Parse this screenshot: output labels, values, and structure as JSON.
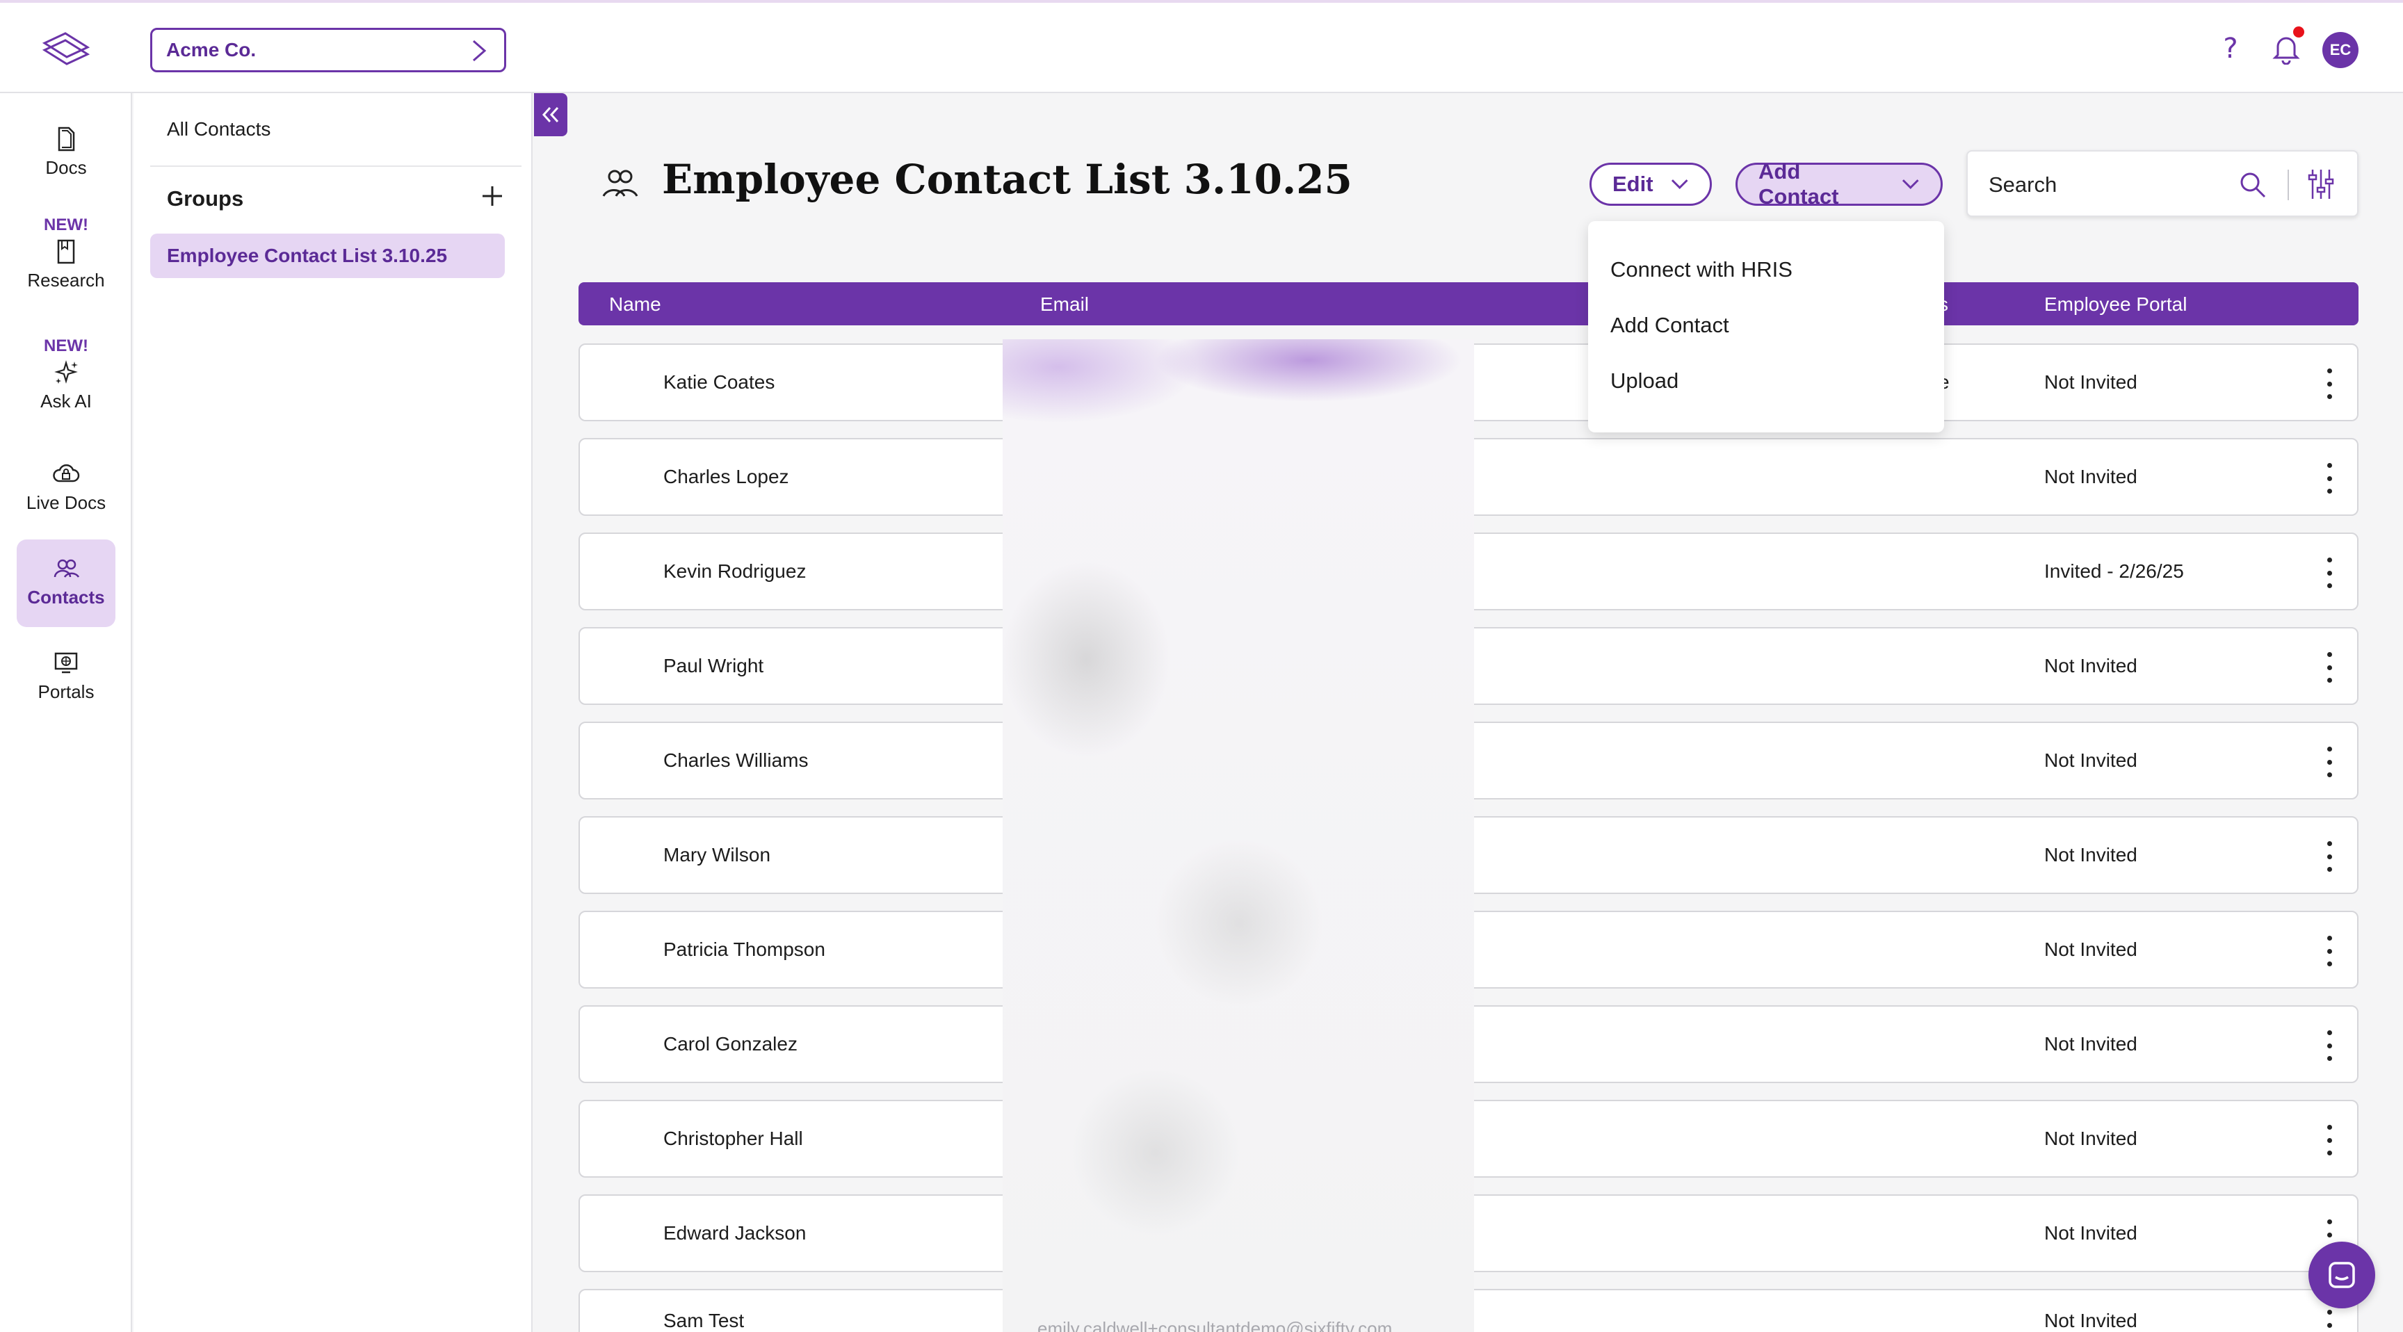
{
  "topbar": {
    "company": "Acme Co.",
    "avatar_initials": "EC",
    "help_glyph": "?"
  },
  "nav": {
    "new_badge": "NEW!",
    "items": [
      {
        "label": "Docs",
        "icon": "document-icon"
      },
      {
        "label": "Research",
        "icon": "book-icon",
        "new": true
      },
      {
        "label": "Ask AI",
        "icon": "sparkles-icon",
        "new": true
      },
      {
        "label": "Live Docs",
        "icon": "cloud-lock-icon"
      },
      {
        "label": "Contacts",
        "icon": "people-icon",
        "active": true
      },
      {
        "label": "Portals",
        "icon": "portal-icon"
      }
    ]
  },
  "groups_panel": {
    "all_contacts": "All Contacts",
    "groups_label": "Groups",
    "groups": [
      "Employee Contact List 3.10.25"
    ]
  },
  "page": {
    "title": "Employee Contact List 3.10.25",
    "edit_label": "Edit",
    "add_contact_label": "Add Contact",
    "search_placeholder": "Search"
  },
  "add_contact_menu": {
    "items": [
      "Connect with HRIS",
      "Add Contact",
      "Upload"
    ]
  },
  "table": {
    "columns": {
      "name": "Name",
      "email": "Email",
      "status_fragment": "s",
      "portal": "Employee Portal"
    },
    "rows": [
      {
        "name": "Katie Coates",
        "status_fragment": "e",
        "portal": "Not Invited"
      },
      {
        "name": "Charles Lopez",
        "portal": "Not Invited"
      },
      {
        "name": "Kevin Rodriguez",
        "portal": "Invited - 2/26/25"
      },
      {
        "name": "Paul Wright",
        "portal": "Not Invited"
      },
      {
        "name": "Charles Williams",
        "portal": "Not Invited"
      },
      {
        "name": "Mary Wilson",
        "portal": "Not Invited"
      },
      {
        "name": "Patricia Thompson",
        "portal": "Not Invited"
      },
      {
        "name": "Carol Gonzalez",
        "portal": "Not Invited"
      },
      {
        "name": "Christopher Hall",
        "portal": "Not Invited"
      },
      {
        "name": "Edward Jackson",
        "portal": "Not Invited"
      },
      {
        "name": "Sam Test",
        "email": "emily.caldwell+consultantdemo@sixfifty.com",
        "portal": "Not Invited"
      }
    ]
  },
  "colors": {
    "brand": "#6b34a8",
    "brand_light": "#e6d6f3",
    "notification": "#e8121b"
  }
}
